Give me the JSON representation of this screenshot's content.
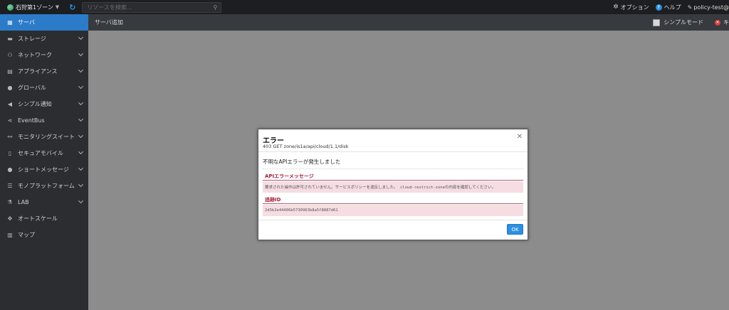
{
  "topbar": {
    "zone_label": "石狩第1ゾーン",
    "search_placeholder": "リソースを検索...",
    "options_label": "オプション",
    "help_label": "ヘルプ",
    "user_label": "policy-test@"
  },
  "sidebar": {
    "items": [
      {
        "label": "サーバ",
        "icon": "server-icon",
        "glyph": "▦",
        "active": true,
        "has_chevron": false
      },
      {
        "label": "ストレージ",
        "icon": "storage-icon",
        "glyph": "▬",
        "active": false,
        "has_chevron": true
      },
      {
        "label": "ネットワーク",
        "icon": "network-icon",
        "glyph": "⚇",
        "active": false,
        "has_chevron": true
      },
      {
        "label": "アプライアンス",
        "icon": "appliance-icon",
        "glyph": "▤",
        "active": false,
        "has_chevron": true
      },
      {
        "label": "グローバル",
        "icon": "globe-icon",
        "glyph": "●",
        "active": false,
        "has_chevron": true
      },
      {
        "label": "シンプル通知",
        "icon": "megaphone-icon",
        "glyph": "◀",
        "active": false,
        "has_chevron": true
      },
      {
        "label": "EventBus",
        "icon": "share-icon",
        "glyph": "⋖",
        "active": false,
        "has_chevron": true
      },
      {
        "label": "モニタリングスイート",
        "icon": "binoculars-icon",
        "glyph": "⚯",
        "active": false,
        "has_chevron": true
      },
      {
        "label": "セキュアモバイル",
        "icon": "mobile-icon",
        "glyph": "▯",
        "active": false,
        "has_chevron": true
      },
      {
        "label": "ショートメッセージ",
        "icon": "chat-icon",
        "glyph": "●",
        "active": false,
        "has_chevron": true
      },
      {
        "label": "モノプラットフォーム",
        "icon": "list-icon",
        "glyph": "☰",
        "active": false,
        "has_chevron": true
      },
      {
        "label": "LAB",
        "icon": "flask-icon",
        "glyph": "⚗",
        "active": false,
        "has_chevron": true
      },
      {
        "label": "オートスケール",
        "icon": "arrows-icon",
        "glyph": "✥",
        "active": false,
        "has_chevron": false
      },
      {
        "label": "マップ",
        "icon": "map-icon",
        "glyph": "▥",
        "active": false,
        "has_chevron": false
      }
    ]
  },
  "subheader": {
    "title": "サーバ追加",
    "simple_mode_label": "シンプルモード",
    "cancel_label": "キャ"
  },
  "modal": {
    "title": "エラー",
    "subtitle": "403 GET zone/is1a/api/cloud/1.1/disk",
    "message": "不明なAPIエラーが発生しました",
    "api_error_label": "APIエラーメッセージ",
    "api_error_text": "要求された操作は許可されていません。サービスポリシーを違反しました。 cloud-restrict-zoneの内容を確認してください。",
    "trace_label": "追跡ID",
    "trace_id": "2d5b2e44406b5730963b8a5f8887d61",
    "ok_label": "OK"
  },
  "colors": {
    "accent": "#2c7bc9",
    "error_text": "#a3213a",
    "error_bg": "#f6dde1"
  }
}
